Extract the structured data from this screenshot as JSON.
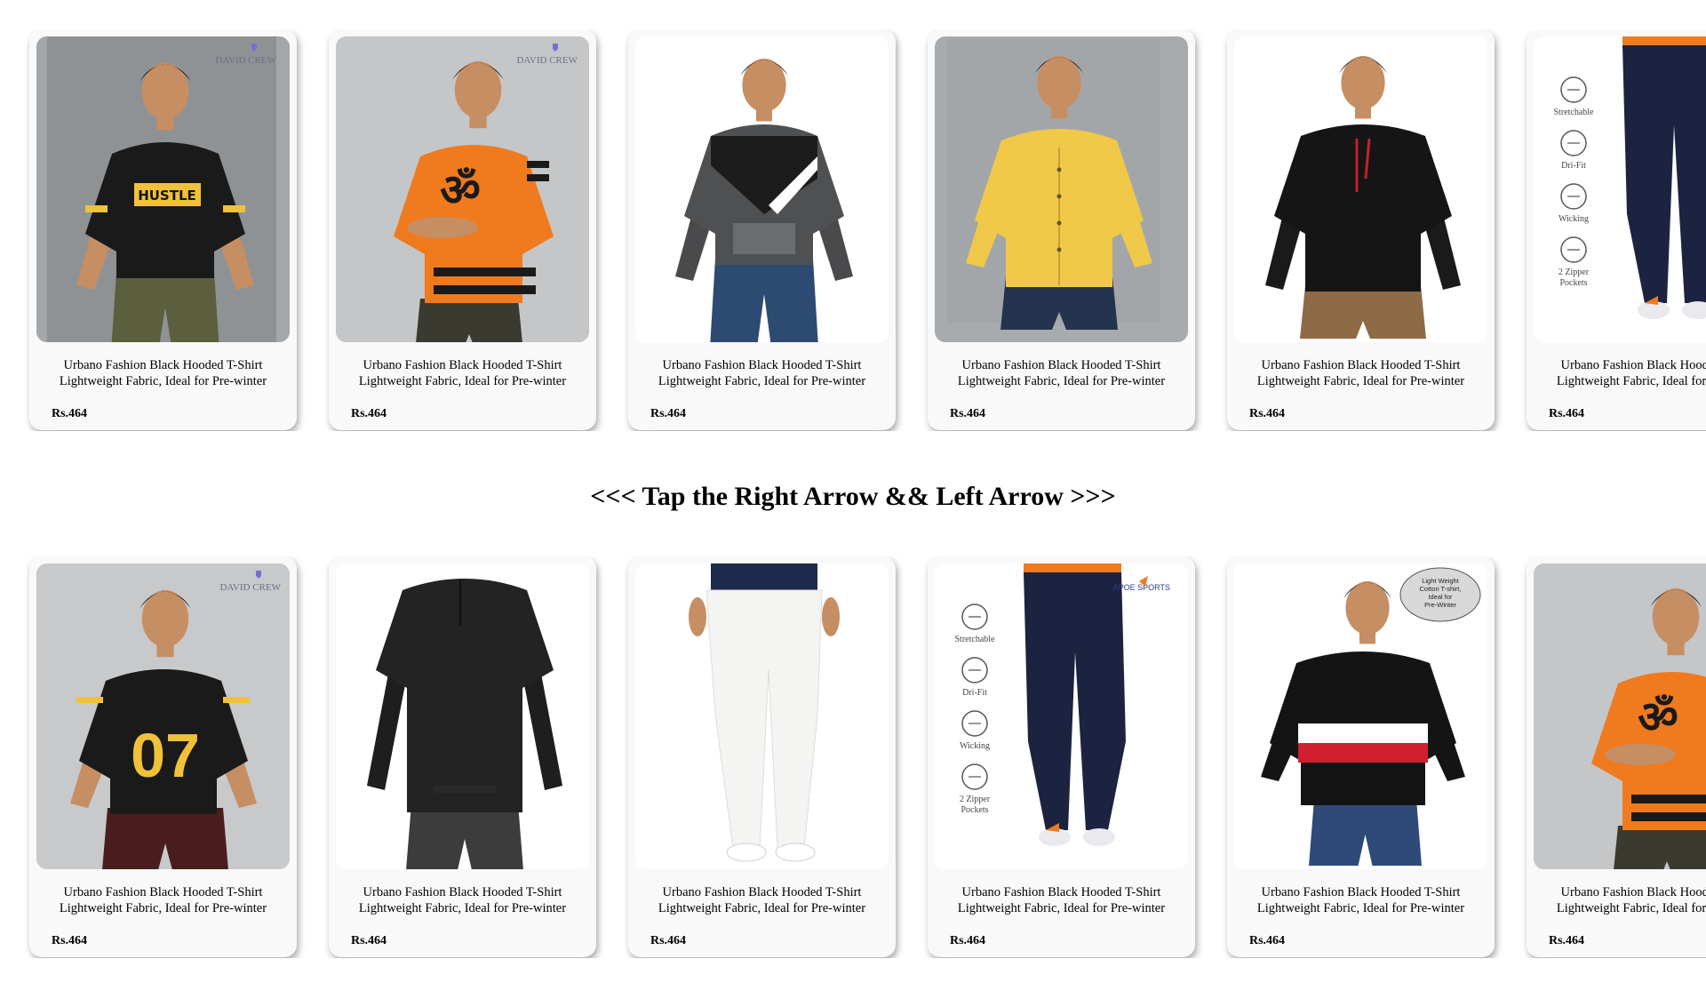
{
  "instructions": "<<< Tap the Right Arrow && Left Arrow >>>",
  "rows": [
    {
      "products": [
        {
          "title_line1": "Urbano Fashion Black Hooded T-Shirt",
          "title_line2": "Lightweight Fabric, Ideal for Pre-winter",
          "price": "Rs.464",
          "image": "black-hustle-tshirt",
          "brand_watermark": "DAVID CREW"
        },
        {
          "title_line1": "Urbano Fashion Black Hooded T-Shirt",
          "title_line2": "Lightweight Fabric, Ideal for Pre-winter",
          "price": "Rs.464",
          "image": "orange-om-tshirt",
          "brand_watermark": "DAVID CREW"
        },
        {
          "title_line1": "Urbano Fashion Black Hooded T-Shirt",
          "title_line2": "Lightweight Fabric, Ideal for Pre-winter",
          "price": "Rs.464",
          "image": "grey-hooded-tshirt"
        },
        {
          "title_line1": "Urbano Fashion Black Hooded T-Shirt",
          "title_line2": "Lightweight Fabric, Ideal for Pre-winter",
          "price": "Rs.464",
          "image": "yellow-shirt"
        },
        {
          "title_line1": "Urbano Fashion Black Hooded T-Shirt",
          "title_line2": "Lightweight Fabric, Ideal for Pre-winter",
          "price": "Rs.464",
          "image": "black-hoodie-red-strings"
        },
        {
          "title_line1": "Urbano Fashion Black Hooded T-Shirt",
          "title_line2": "Lightweight Fabric, Ideal for Pre-winter",
          "price": "Rs.464",
          "image": "navy-track-pants",
          "features": [
            "Stretchable",
            "Dri-Fit",
            "Wicking",
            "2 Zipper Pockets"
          ]
        }
      ]
    },
    {
      "products": [
        {
          "title_line1": "Urbano Fashion Black Hooded T-Shirt",
          "title_line2": "Lightweight Fabric, Ideal for Pre-winter",
          "price": "Rs.464",
          "image": "black-07-tshirt",
          "brand_watermark": "DAVID CREW"
        },
        {
          "title_line1": "Urbano Fashion Black Hooded T-Shirt",
          "title_line2": "Lightweight Fabric, Ideal for Pre-winter",
          "price": "Rs.464",
          "image": "black-henley"
        },
        {
          "title_line1": "Urbano Fashion Black Hooded T-Shirt",
          "title_line2": "Lightweight Fabric, Ideal for Pre-winter",
          "price": "Rs.464",
          "image": "white-jeans"
        },
        {
          "title_line1": "Urbano Fashion Black Hooded T-Shirt",
          "title_line2": "Lightweight Fabric, Ideal for Pre-winter",
          "price": "Rs.464",
          "image": "navy-track-pants",
          "features": [
            "Stretchable",
            "Dri-Fit",
            "Wicking",
            "2 Zipper Pockets"
          ],
          "brand_watermark": "APOE SPORTS"
        },
        {
          "title_line1": "Urbano Fashion Black Hooded T-Shirt",
          "title_line2": "Lightweight Fabric, Ideal for Pre-winter",
          "price": "Rs.464",
          "image": "striped-hoodie",
          "badge": [
            "Light Weight",
            "Cotton T-shirt,",
            "Ideal for",
            "Pre-Winter"
          ]
        },
        {
          "title_line1": "Urbano Fashion Black Hooded T-Shirt",
          "title_line2": "Lightweight Fabric, Ideal for Pre-winter",
          "price": "Rs.464",
          "image": "orange-om-tshirt"
        }
      ]
    }
  ],
  "colors": {
    "card_bg": "#f9f9f9",
    "orange": "#f07a1e",
    "yellow": "#f0c23a",
    "navy": "#1c2340",
    "black_cloth": "#1a1a1a",
    "grey_bg": "#b9bcbe"
  }
}
